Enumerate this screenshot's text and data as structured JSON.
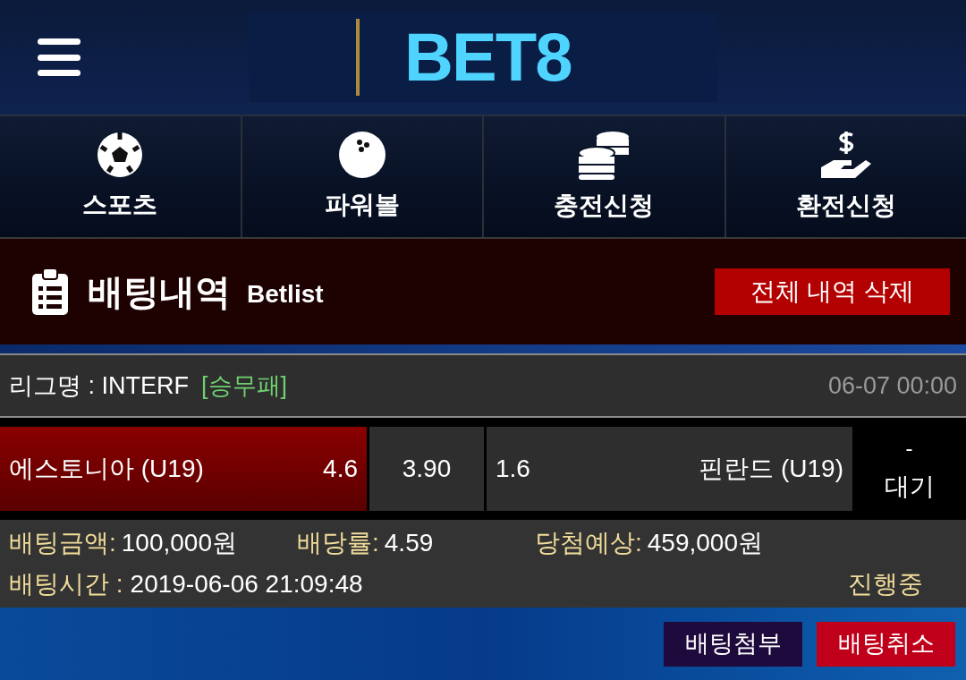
{
  "header": {
    "logo": "BET8"
  },
  "nav": [
    {
      "label": "스포츠",
      "kind": "soccer"
    },
    {
      "label": "파워볼",
      "kind": "ball"
    },
    {
      "label": "충전신청",
      "kind": "coins"
    },
    {
      "label": "환전신청",
      "kind": "hand"
    }
  ],
  "section": {
    "title": "배팅내역",
    "subtitle": "Betlist",
    "delete_button": "전체 내역 삭제"
  },
  "bet": {
    "league": "리그명 : INTERF",
    "market": "[승무패]",
    "time": "06-07 00:00",
    "home": {
      "team": "에스토니아 (U19)",
      "odds": "4.6",
      "selected": true
    },
    "draw": {
      "odds": "3.90",
      "selected": false
    },
    "away": {
      "team": "핀란드 (U19)",
      "odds": "1.6",
      "selected": false
    },
    "result": {
      "score": "-",
      "status": "대기"
    },
    "info": [
      {
        "label": "배팅금액:",
        "value": "100,000원"
      },
      {
        "label": "배당률:",
        "value": "4.59"
      },
      {
        "label": "당첨예상:",
        "value": "459,000원"
      }
    ],
    "time_row": {
      "label": "배팅시간 :",
      "value": "2019-06-06 21:09:48"
    },
    "progress": "진행중"
  },
  "actions": [
    {
      "label": "배팅첨부",
      "kind": "attach"
    },
    {
      "label": "배팅취소",
      "kind": "cancel"
    }
  ]
}
